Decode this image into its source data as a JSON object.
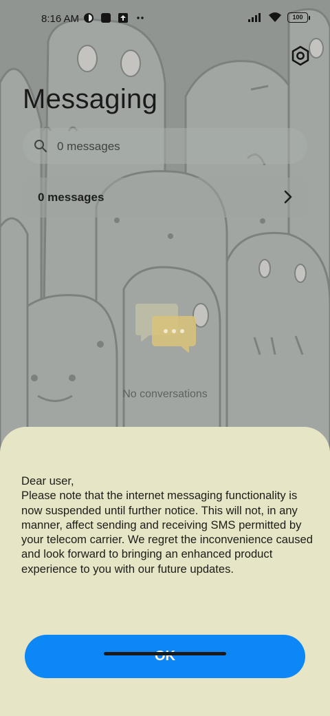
{
  "status_bar": {
    "time": "8:16 AM",
    "battery": "100",
    "left_icons": [
      "app-notification-icon",
      "square-notification-icon",
      "upload-notification-icon",
      "more-dots-icon"
    ],
    "right_icons": [
      "signal-icon",
      "wifi-icon",
      "battery-icon"
    ]
  },
  "header": {
    "title": "Messaging",
    "settings_icon": "settings-icon"
  },
  "search": {
    "placeholder": "0 messages"
  },
  "messages_row": {
    "label": "0 messages"
  },
  "empty_state": {
    "text": "No conversations"
  },
  "dialog": {
    "message": "Dear user,\nPlease note that the internet messaging functionality is now suspended until further notice. This will not, in any manner, affect sending and receiving SMS permitted by your telecom carrier. We regret the inconvenience caused and look forward to bringing an enhanced product experience to you with our future updates.",
    "ok_label": "OK"
  },
  "colors": {
    "accent": "#0d86f6",
    "sheet_bg": "#e6e5c6",
    "empty_icon": "#d9c37a"
  }
}
